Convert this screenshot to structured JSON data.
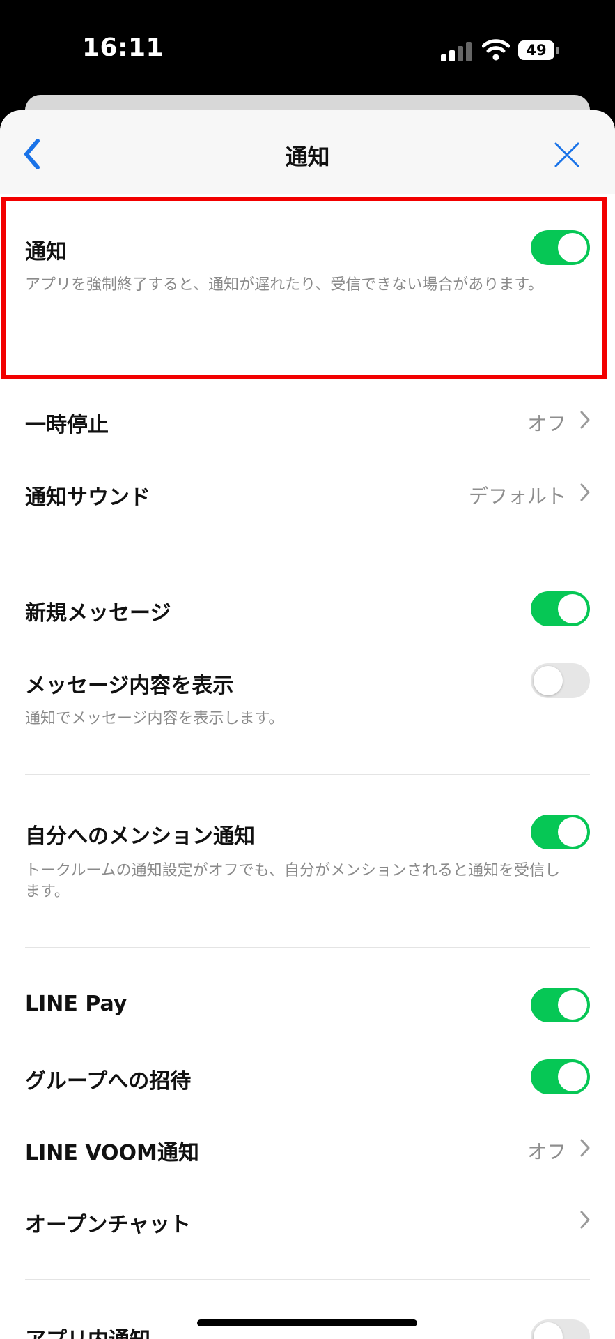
{
  "status_bar": {
    "time": "16:11",
    "battery": "49"
  },
  "nav": {
    "title": "通知"
  },
  "notification": {
    "title": "通知",
    "description": "アプリを強制終了すると、通知が遅れたり、受信できない場合があります。",
    "enabled": true
  },
  "pause": {
    "label": "一時停止",
    "value": "オフ"
  },
  "sound": {
    "label": "通知サウンド",
    "value": "デフォルト"
  },
  "new_message": {
    "label": "新規メッセージ",
    "enabled": true
  },
  "show_content": {
    "label": "メッセージ内容を表示",
    "description": "通知でメッセージ内容を表示します。",
    "enabled": false
  },
  "mention": {
    "label": "自分へのメンション通知",
    "description": "トークルームの通知設定がオフでも、自分がメンションされると通知を受信します。",
    "enabled": true
  },
  "line_pay": {
    "label": "LINE Pay",
    "enabled": true
  },
  "group_invite": {
    "label": "グループへの招待",
    "enabled": true
  },
  "line_voom": {
    "label": "LINE VOOM通知",
    "value": "オフ"
  },
  "open_chat": {
    "label": "オープンチャット"
  },
  "in_app": {
    "label": "アプリ内通知",
    "enabled": false
  },
  "colors": {
    "toggle_on": "#06c755",
    "highlight": "#f20000",
    "accent": "#1a73e8"
  }
}
